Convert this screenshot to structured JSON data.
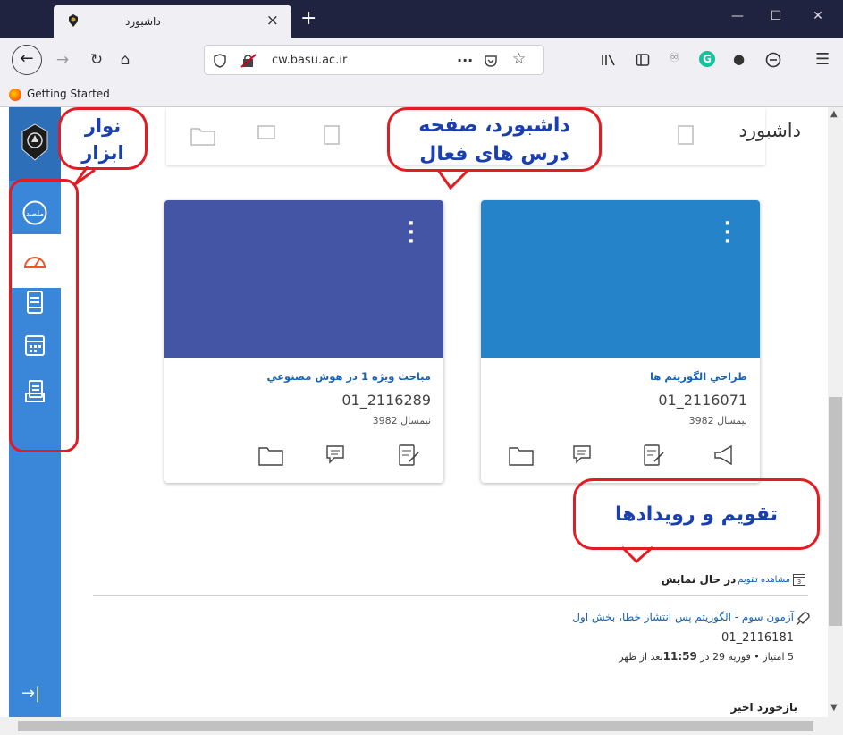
{
  "browser": {
    "tab_title": "داشبورد",
    "tab_close": "×",
    "new_tab": "+",
    "win_min": "—",
    "win_max": "☐",
    "win_close": "✕",
    "url": "cw.basu.ac.ir",
    "url_more": "···",
    "bookmark": "Getting Started",
    "menu": "☰"
  },
  "page": {
    "title": "داشبورد"
  },
  "sidebar": {
    "items": [
      "blog-icon",
      "dashboard-icon",
      "courses-icon",
      "calendar-icon",
      "reports-icon"
    ],
    "collapse": "→|"
  },
  "courses": [
    {
      "title": "طراحي الگوريتم ها",
      "code": "01_2116071",
      "term": "نیمسال 3982",
      "color": "#2483c9"
    },
    {
      "title": "مباحث ويژه 1 در هوش مصنوعي",
      "code": "01_2116289",
      "term": "نیمسال 3982",
      "color": "#4455a6"
    }
  ],
  "calendar": {
    "heading": "در حال نمایش",
    "view_link": "مشاهده تقویم",
    "event_title": "آزمون سوم - الگوریتم پس انتشار خطا، بخش اول",
    "event_code": "01_2116181",
    "event_meta_prefix": "5 امتیاز • فوریه 29 در ",
    "event_time": "11:59",
    "event_meta_suffix": "بعد از ظهر"
  },
  "recent_feedback": {
    "heading": "بازخورد اخیر"
  },
  "annotations": {
    "toolbar_line1": "نوار",
    "toolbar_line2": "ابزار",
    "dashboard_line1": "داشبورد، صفحه",
    "dashboard_line2": "درس های فعال",
    "calendar": "تقویم و رویدادها"
  },
  "colors": {
    "sidebar": "#3a86d8",
    "annotation_border": "#e31b23",
    "annotation_text": "#1a3fb0",
    "titlebar": "#202340"
  }
}
